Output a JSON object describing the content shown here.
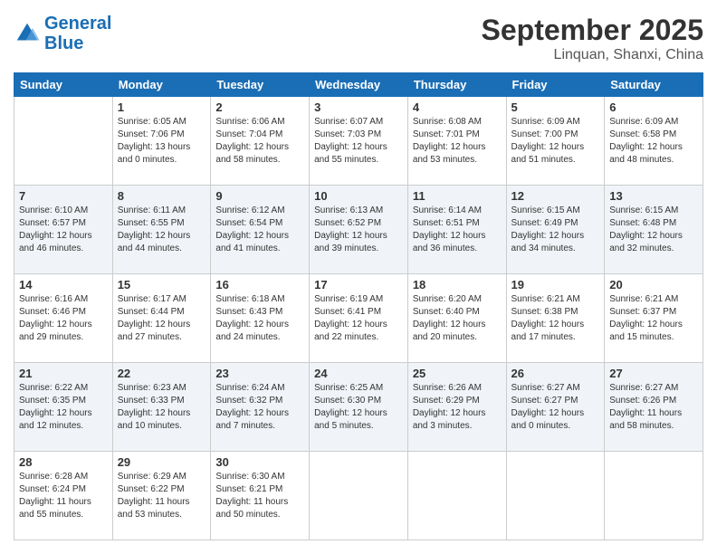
{
  "header": {
    "logo_line1": "General",
    "logo_line2": "Blue",
    "month_year": "September 2025",
    "location": "Linquan, Shanxi, China"
  },
  "weekdays": [
    "Sunday",
    "Monday",
    "Tuesday",
    "Wednesday",
    "Thursday",
    "Friday",
    "Saturday"
  ],
  "weeks": [
    [
      {
        "day": "",
        "info": ""
      },
      {
        "day": "1",
        "info": "Sunrise: 6:05 AM\nSunset: 7:06 PM\nDaylight: 13 hours\nand 0 minutes."
      },
      {
        "day": "2",
        "info": "Sunrise: 6:06 AM\nSunset: 7:04 PM\nDaylight: 12 hours\nand 58 minutes."
      },
      {
        "day": "3",
        "info": "Sunrise: 6:07 AM\nSunset: 7:03 PM\nDaylight: 12 hours\nand 55 minutes."
      },
      {
        "day": "4",
        "info": "Sunrise: 6:08 AM\nSunset: 7:01 PM\nDaylight: 12 hours\nand 53 minutes."
      },
      {
        "day": "5",
        "info": "Sunrise: 6:09 AM\nSunset: 7:00 PM\nDaylight: 12 hours\nand 51 minutes."
      },
      {
        "day": "6",
        "info": "Sunrise: 6:09 AM\nSunset: 6:58 PM\nDaylight: 12 hours\nand 48 minutes."
      }
    ],
    [
      {
        "day": "7",
        "info": "Sunrise: 6:10 AM\nSunset: 6:57 PM\nDaylight: 12 hours\nand 46 minutes."
      },
      {
        "day": "8",
        "info": "Sunrise: 6:11 AM\nSunset: 6:55 PM\nDaylight: 12 hours\nand 44 minutes."
      },
      {
        "day": "9",
        "info": "Sunrise: 6:12 AM\nSunset: 6:54 PM\nDaylight: 12 hours\nand 41 minutes."
      },
      {
        "day": "10",
        "info": "Sunrise: 6:13 AM\nSunset: 6:52 PM\nDaylight: 12 hours\nand 39 minutes."
      },
      {
        "day": "11",
        "info": "Sunrise: 6:14 AM\nSunset: 6:51 PM\nDaylight: 12 hours\nand 36 minutes."
      },
      {
        "day": "12",
        "info": "Sunrise: 6:15 AM\nSunset: 6:49 PM\nDaylight: 12 hours\nand 34 minutes."
      },
      {
        "day": "13",
        "info": "Sunrise: 6:15 AM\nSunset: 6:48 PM\nDaylight: 12 hours\nand 32 minutes."
      }
    ],
    [
      {
        "day": "14",
        "info": "Sunrise: 6:16 AM\nSunset: 6:46 PM\nDaylight: 12 hours\nand 29 minutes."
      },
      {
        "day": "15",
        "info": "Sunrise: 6:17 AM\nSunset: 6:44 PM\nDaylight: 12 hours\nand 27 minutes."
      },
      {
        "day": "16",
        "info": "Sunrise: 6:18 AM\nSunset: 6:43 PM\nDaylight: 12 hours\nand 24 minutes."
      },
      {
        "day": "17",
        "info": "Sunrise: 6:19 AM\nSunset: 6:41 PM\nDaylight: 12 hours\nand 22 minutes."
      },
      {
        "day": "18",
        "info": "Sunrise: 6:20 AM\nSunset: 6:40 PM\nDaylight: 12 hours\nand 20 minutes."
      },
      {
        "day": "19",
        "info": "Sunrise: 6:21 AM\nSunset: 6:38 PM\nDaylight: 12 hours\nand 17 minutes."
      },
      {
        "day": "20",
        "info": "Sunrise: 6:21 AM\nSunset: 6:37 PM\nDaylight: 12 hours\nand 15 minutes."
      }
    ],
    [
      {
        "day": "21",
        "info": "Sunrise: 6:22 AM\nSunset: 6:35 PM\nDaylight: 12 hours\nand 12 minutes."
      },
      {
        "day": "22",
        "info": "Sunrise: 6:23 AM\nSunset: 6:33 PM\nDaylight: 12 hours\nand 10 minutes."
      },
      {
        "day": "23",
        "info": "Sunrise: 6:24 AM\nSunset: 6:32 PM\nDaylight: 12 hours\nand 7 minutes."
      },
      {
        "day": "24",
        "info": "Sunrise: 6:25 AM\nSunset: 6:30 PM\nDaylight: 12 hours\nand 5 minutes."
      },
      {
        "day": "25",
        "info": "Sunrise: 6:26 AM\nSunset: 6:29 PM\nDaylight: 12 hours\nand 3 minutes."
      },
      {
        "day": "26",
        "info": "Sunrise: 6:27 AM\nSunset: 6:27 PM\nDaylight: 12 hours\nand 0 minutes."
      },
      {
        "day": "27",
        "info": "Sunrise: 6:27 AM\nSunset: 6:26 PM\nDaylight: 11 hours\nand 58 minutes."
      }
    ],
    [
      {
        "day": "28",
        "info": "Sunrise: 6:28 AM\nSunset: 6:24 PM\nDaylight: 11 hours\nand 55 minutes."
      },
      {
        "day": "29",
        "info": "Sunrise: 6:29 AM\nSunset: 6:22 PM\nDaylight: 11 hours\nand 53 minutes."
      },
      {
        "day": "30",
        "info": "Sunrise: 6:30 AM\nSunset: 6:21 PM\nDaylight: 11 hours\nand 50 minutes."
      },
      {
        "day": "",
        "info": ""
      },
      {
        "day": "",
        "info": ""
      },
      {
        "day": "",
        "info": ""
      },
      {
        "day": "",
        "info": ""
      }
    ]
  ]
}
